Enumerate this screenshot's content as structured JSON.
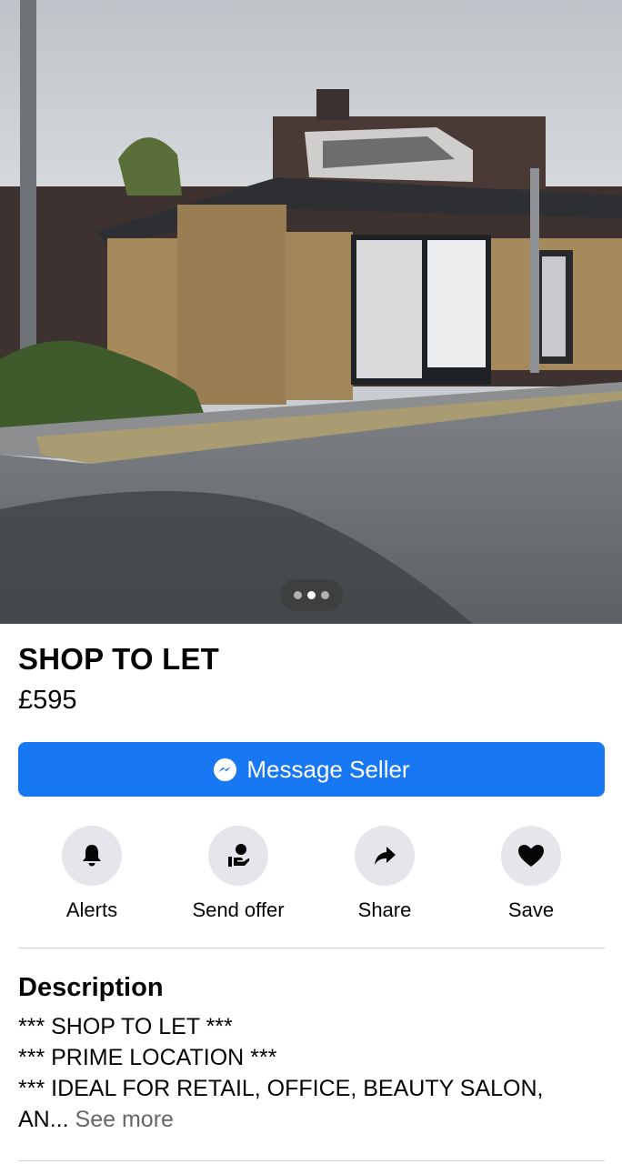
{
  "listing": {
    "title": "SHOP TO LET",
    "price": "£595"
  },
  "photo": {
    "pager_dots": 3,
    "active_dot": 2
  },
  "primary_action": {
    "label": "Message Seller",
    "icon": "messenger-icon",
    "color": "#1877f2"
  },
  "actions": [
    {
      "label": "Alerts",
      "icon": "bell-icon"
    },
    {
      "label": "Send offer",
      "icon": "offer-hand-icon"
    },
    {
      "label": "Share",
      "icon": "share-arrow-icon"
    },
    {
      "label": "Save",
      "icon": "heart-icon"
    }
  ],
  "description": {
    "heading": "Description",
    "lines": [
      "*** SHOP TO LET ***",
      "*** PRIME LOCATION ***",
      "*** IDEAL FOR RETAIL, OFFICE, BEAUTY SALON,",
      "AN..."
    ],
    "see_more": "See more"
  }
}
